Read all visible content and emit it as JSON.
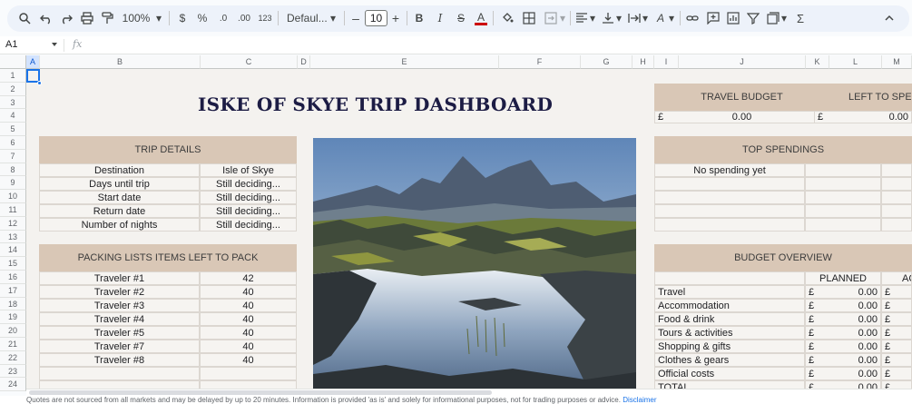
{
  "toolbar": {
    "zoom": "100%",
    "currency": "$",
    "percent": "%",
    "dec_decrease": ".0",
    "dec_increase": ".00",
    "number_format": "123",
    "font": "Defaul...",
    "font_size": "10"
  },
  "formula_bar": {
    "cell_ref": "A1",
    "fx": "fx"
  },
  "columns": [
    "A",
    "B",
    "C",
    "D",
    "E",
    "F",
    "G",
    "H",
    "I",
    "J",
    "K",
    "L",
    "M"
  ],
  "rows": [
    "1",
    "2",
    "3",
    "4",
    "5",
    "6",
    "7",
    "8",
    "9",
    "10",
    "11",
    "12",
    "13",
    "14",
    "15",
    "16",
    "17",
    "18",
    "19",
    "20",
    "21",
    "22",
    "23",
    "24"
  ],
  "dashboard_title": "ISKE OF SKYE TRIP DASHBOARD",
  "trip_details": {
    "header": "TRIP DETAILS",
    "rows": [
      {
        "label": "Destination",
        "value": "Isle of Skye"
      },
      {
        "label": "Days until trip",
        "value": "Still deciding..."
      },
      {
        "label": "Start date",
        "value": "Still deciding..."
      },
      {
        "label": "Return date",
        "value": "Still deciding..."
      },
      {
        "label": "Number of nights",
        "value": "Still deciding..."
      }
    ]
  },
  "packing": {
    "header": "PACKING LISTS ITEMS LEFT TO PACK",
    "rows": [
      {
        "label": "Traveler #1",
        "value": "42"
      },
      {
        "label": "Traveler #2",
        "value": "40"
      },
      {
        "label": "Traveler #3",
        "value": "40"
      },
      {
        "label": "Traveler #4",
        "value": "40"
      },
      {
        "label": "Traveler #5",
        "value": "40"
      },
      {
        "label": "Traveler #7",
        "value": "40"
      },
      {
        "label": "Traveler #8",
        "value": "40"
      }
    ]
  },
  "travel_budget": {
    "header": "TRAVEL BUDGET",
    "left_header": "LEFT TO SPEN",
    "currency": "£",
    "budget_value": "0.00",
    "left_value": "0.00"
  },
  "top_spendings": {
    "header": "TOP SPENDINGS",
    "empty": "No spending yet"
  },
  "budget_overview": {
    "header": "BUDGET OVERVIEW",
    "planned_label": "PLANNED",
    "actual_label": "AC",
    "currency": "£",
    "rows": [
      {
        "label": "Travel",
        "planned": "0.00"
      },
      {
        "label": "Accommodation",
        "planned": "0.00"
      },
      {
        "label": "Food & drink",
        "planned": "0.00"
      },
      {
        "label": "Tours & activities",
        "planned": "0.00"
      },
      {
        "label": "Shopping & gifts",
        "planned": "0.00"
      },
      {
        "label": "Clothes & gears",
        "planned": "0.00"
      },
      {
        "label": "Official costs",
        "planned": "0.00"
      },
      {
        "label": "TOTAL",
        "planned": "0.00"
      }
    ]
  },
  "footer": {
    "text": "Quotes are not sourced from all markets and may be delayed by up to 20 minutes. Information is provided 'as is' and solely for informational purposes, not for trading purposes or advice.",
    "link": "Disclaimer"
  }
}
